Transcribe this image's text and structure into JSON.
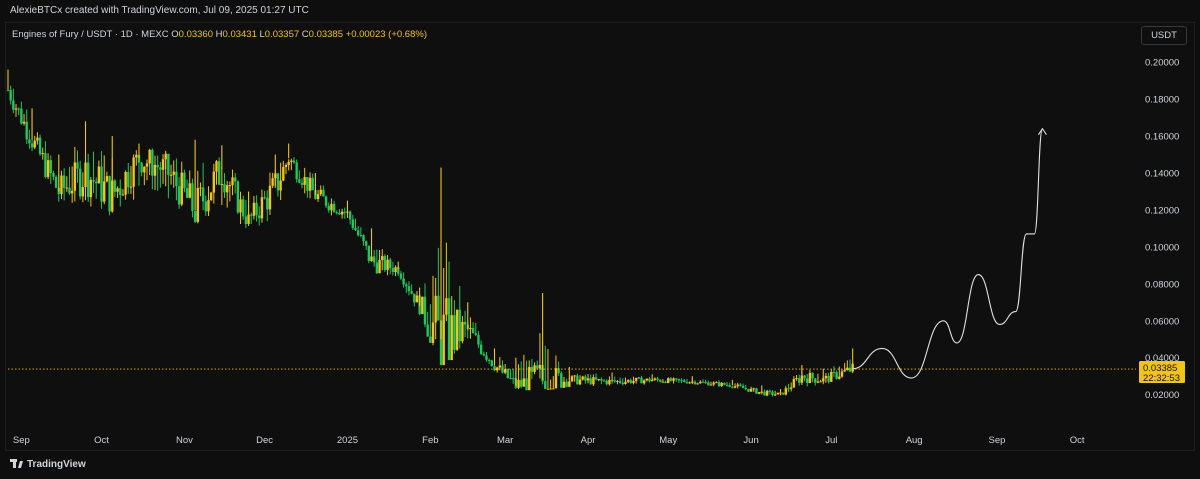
{
  "header": {
    "created_by": "AlexieBTCx created with TradingView.com, Jul 09, 2025 01:27 UTC"
  },
  "legend": {
    "symbol": "Engines of Fury / USDT · 1D · MEXC",
    "open_label": "O",
    "open": "0.03360",
    "high_label": "H",
    "high": "0.03431",
    "low_label": "L",
    "low": "0.03357",
    "close_label": "C",
    "close": "0.03385",
    "change": "+0.00023 (+0.68%)"
  },
  "currency_button": "USDT",
  "price_tag": {
    "price": "0.03385",
    "countdown": "22:32:53"
  },
  "footer": {
    "brand": "TradingView"
  },
  "colors": {
    "background": "#0f0f0f",
    "up_candle": "#f0c419",
    "down_candle": "#22c55e",
    "projection": "#e0e0e0",
    "price_line": "#f0c419"
  },
  "chart_data": {
    "type": "candlestick",
    "title": "Engines of Fury / USDT · 1D · MEXC",
    "x_axis": {
      "labels": [
        "Sep",
        "Oct",
        "Nov",
        "Dec",
        "2025",
        "Feb",
        "Mar",
        "Apr",
        "May",
        "Jun",
        "Jul",
        "Aug",
        "Sep",
        "Oct"
      ],
      "dates": [
        "2024-09-01",
        "2024-10-01",
        "2024-11-01",
        "2024-12-01",
        "2025-01-01",
        "2025-02-01",
        "2025-03-01",
        "2025-04-01",
        "2025-05-01",
        "2025-06-01",
        "2025-07-01",
        "2025-08-01",
        "2025-09-01",
        "2025-10-01"
      ],
      "range": [
        "2024-08-27",
        "2025-10-23"
      ]
    },
    "y_axis": {
      "ticks": [
        "0.20000",
        "0.18000",
        "0.16000",
        "0.14000",
        "0.12000",
        "0.10000",
        "0.08000",
        "0.06000",
        "0.04000",
        "0.02000"
      ],
      "range": [
        0.0106,
        0.2039
      ]
    },
    "grid": false,
    "price_series": {
      "name": "Engines of Fury / USDT",
      "points": [
        {
          "date": "2024-08-27",
          "close": 0.185,
          "high": 0.196,
          "low": 0.175
        },
        {
          "date": "2024-09-05",
          "close": 0.158,
          "high": 0.175,
          "low": 0.148
        },
        {
          "date": "2024-09-15",
          "close": 0.13,
          "high": 0.15,
          "low": 0.118
        },
        {
          "date": "2024-09-25",
          "close": 0.14,
          "high": 0.168,
          "low": 0.12
        },
        {
          "date": "2024-10-05",
          "close": 0.128,
          "high": 0.16,
          "low": 0.112
        },
        {
          "date": "2024-10-15",
          "close": 0.148,
          "high": 0.156,
          "low": 0.122
        },
        {
          "date": "2024-10-25",
          "close": 0.142,
          "high": 0.152,
          "low": 0.118
        },
        {
          "date": "2024-11-05",
          "close": 0.12,
          "high": 0.158,
          "low": 0.11
        },
        {
          "date": "2024-11-15",
          "close": 0.142,
          "high": 0.155,
          "low": 0.112
        },
        {
          "date": "2024-11-25",
          "close": 0.114,
          "high": 0.13,
          "low": 0.106
        },
        {
          "date": "2024-12-05",
          "close": 0.132,
          "high": 0.15,
          "low": 0.11
        },
        {
          "date": "2024-12-10",
          "close": 0.148,
          "high": 0.156,
          "low": 0.135
        },
        {
          "date": "2024-12-20",
          "close": 0.128,
          "high": 0.14,
          "low": 0.118
        },
        {
          "date": "2025-01-01",
          "close": 0.118,
          "high": 0.125,
          "low": 0.112
        },
        {
          "date": "2025-01-10",
          "close": 0.092,
          "high": 0.11,
          "low": 0.085
        },
        {
          "date": "2025-01-20",
          "close": 0.088,
          "high": 0.092,
          "low": 0.08
        },
        {
          "date": "2025-01-28",
          "close": 0.068,
          "high": 0.078,
          "low": 0.06
        },
        {
          "date": "2025-02-05",
          "close": 0.05,
          "high": 0.143,
          "low": 0.036
        },
        {
          "date": "2025-02-15",
          "close": 0.055,
          "high": 0.07,
          "low": 0.045
        },
        {
          "date": "2025-02-25",
          "close": 0.036,
          "high": 0.045,
          "low": 0.031
        },
        {
          "date": "2025-03-05",
          "close": 0.025,
          "high": 0.04,
          "low": 0.022
        },
        {
          "date": "2025-03-15",
          "close": 0.028,
          "high": 0.075,
          "low": 0.023
        },
        {
          "date": "2025-03-25",
          "close": 0.028,
          "high": 0.035,
          "low": 0.024
        },
        {
          "date": "2025-04-10",
          "close": 0.027,
          "high": 0.032,
          "low": 0.024
        },
        {
          "date": "2025-04-25",
          "close": 0.028,
          "high": 0.031,
          "low": 0.025
        },
        {
          "date": "2025-05-10",
          "close": 0.027,
          "high": 0.03,
          "low": 0.025
        },
        {
          "date": "2025-05-25",
          "close": 0.025,
          "high": 0.028,
          "low": 0.023
        },
        {
          "date": "2025-06-05",
          "close": 0.021,
          "high": 0.025,
          "low": 0.019
        },
        {
          "date": "2025-06-12",
          "close": 0.02,
          "high": 0.023,
          "low": 0.018
        },
        {
          "date": "2025-06-20",
          "close": 0.03,
          "high": 0.036,
          "low": 0.022
        },
        {
          "date": "2025-06-28",
          "close": 0.028,
          "high": 0.034,
          "low": 0.024
        },
        {
          "date": "2025-07-09",
          "close": 0.03385,
          "high": 0.045,
          "low": 0.031
        }
      ]
    },
    "projection": {
      "points": [
        {
          "date": "2025-07-09",
          "value": 0.034
        },
        {
          "date": "2025-07-20",
          "value": 0.045
        },
        {
          "date": "2025-07-31",
          "value": 0.029
        },
        {
          "date": "2025-08-12",
          "value": 0.06
        },
        {
          "date": "2025-08-17",
          "value": 0.048
        },
        {
          "date": "2025-08-25",
          "value": 0.085
        },
        {
          "date": "2025-09-02",
          "value": 0.058
        },
        {
          "date": "2025-09-08",
          "value": 0.065
        },
        {
          "date": "2025-09-12",
          "value": 0.107
        },
        {
          "date": "2025-09-15",
          "value": 0.107
        },
        {
          "date": "2025-09-18",
          "value": 0.164
        }
      ]
    },
    "current_price_line": 0.03385
  }
}
